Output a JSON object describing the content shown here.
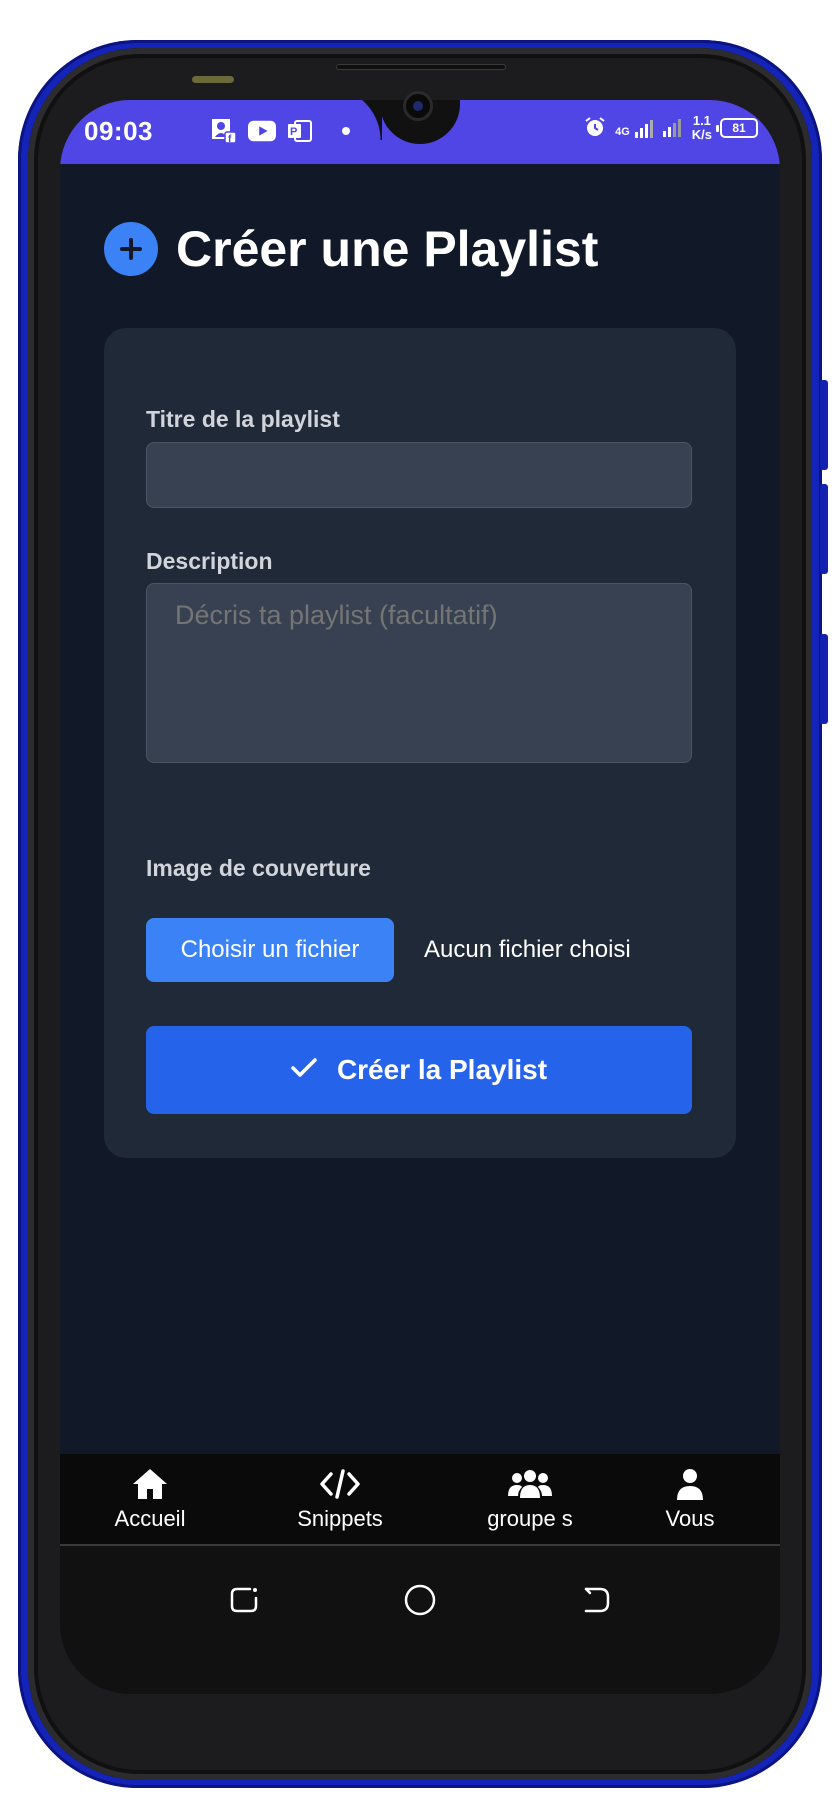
{
  "statusbar": {
    "time": "09:03",
    "network": "4G",
    "speed_value": "1.1",
    "speed_unit": "K/s",
    "battery": "81"
  },
  "header": {
    "title": "Créer une Playlist",
    "icon": "plus-circle-icon"
  },
  "form": {
    "title_label": "Titre de la playlist",
    "title_value": "",
    "description_label": "Description",
    "description_placeholder": "Décris ta playlist (facultatif)",
    "cover_label": "Image de couverture",
    "file_button_label": "Choisir un fichier",
    "file_status": "Aucun fichier choisi",
    "submit_label": "Créer la Playlist"
  },
  "bottom_nav": {
    "items": [
      {
        "label": "Accueil",
        "icon": "home-icon"
      },
      {
        "label": "Snippets",
        "icon": "code-icon"
      },
      {
        "label": "groupe s",
        "icon": "users-icon"
      },
      {
        "label": "Vous",
        "icon": "user-icon"
      }
    ]
  },
  "colors": {
    "statusbar": "#4f46e5",
    "background": "#111827",
    "card": "#1f2937",
    "input": "#374151",
    "accent": "#3b82f6",
    "primary_button": "#2563eb"
  }
}
